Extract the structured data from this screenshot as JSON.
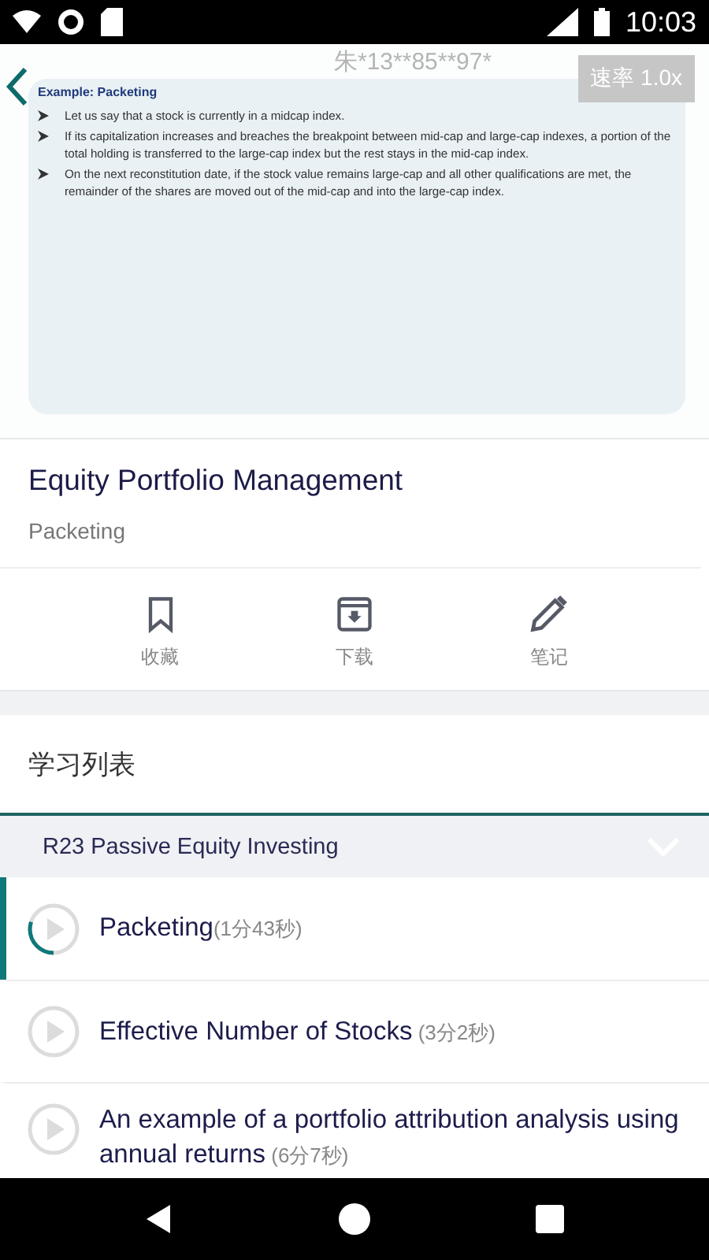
{
  "status_bar": {
    "time": "10:03"
  },
  "video": {
    "slide_title": "Example: Packeting",
    "bullets": [
      "Let us say that a stock is currently in a midcap index.",
      "If its capitalization increases and breaches the breakpoint between mid-cap and large-cap indexes, a portion of the total holding is transferred to the large-cap index but the rest stays in the mid-cap index.",
      "On the next reconstitution date, if the stock value remains large-cap and all other qualifications are met, the remainder of the shares are moved out of the mid-cap and into the large-cap index."
    ],
    "watermark": "朱*13**85**97*",
    "speed": "速率 1.0x"
  },
  "course": {
    "title": "Equity Portfolio Management",
    "subtitle": "Packeting"
  },
  "actions": [
    {
      "kind": "bookmark",
      "label": "收藏"
    },
    {
      "kind": "download",
      "label": "下载"
    },
    {
      "kind": "note",
      "label": "笔记"
    }
  ],
  "list_title": "学习列表",
  "chapter": {
    "title": "R23 Passive Equity Investing",
    "expanded": true
  },
  "lessons": [
    {
      "title": "Packeting",
      "duration": "(1分43秒)",
      "selected": true
    },
    {
      "title": "Effective Number of Stocks",
      "duration": "(3分2秒)",
      "selected": false
    },
    {
      "title": "An example of a portfolio attribution analysis using annual returns",
      "duration": "(6分7秒)",
      "selected": false
    }
  ]
}
